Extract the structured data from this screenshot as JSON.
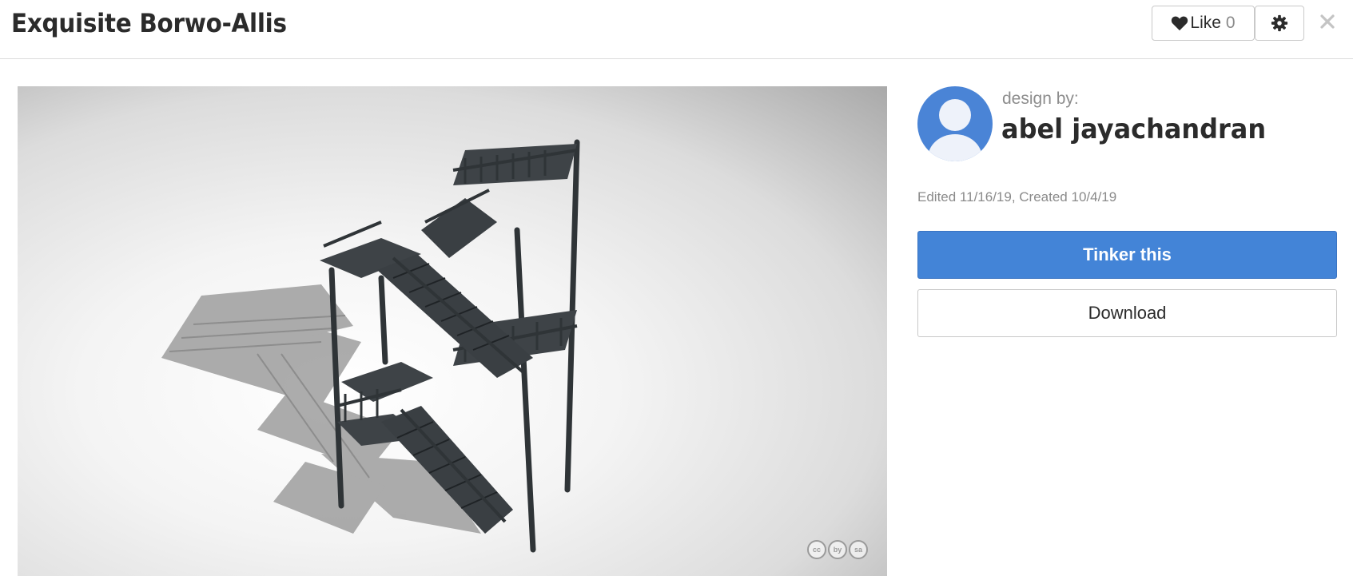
{
  "header": {
    "title": "Exquisite Borwo-Allis",
    "like_label": "Like",
    "like_count": "0",
    "icons": [
      "heart-icon",
      "gear-icon",
      "close-icon"
    ]
  },
  "preview": {
    "license_badges": [
      "cc",
      "by",
      "sa"
    ]
  },
  "designer": {
    "label": "design by:",
    "name": "abel jayachandran",
    "dates": "Edited 11/16/19, Created 10/4/19"
  },
  "actions": {
    "tinker_label": "Tinker this",
    "download_label": "Download"
  },
  "colors": {
    "accent": "#4384d7",
    "avatar": "#4a84d6",
    "model": "#3e4347"
  }
}
